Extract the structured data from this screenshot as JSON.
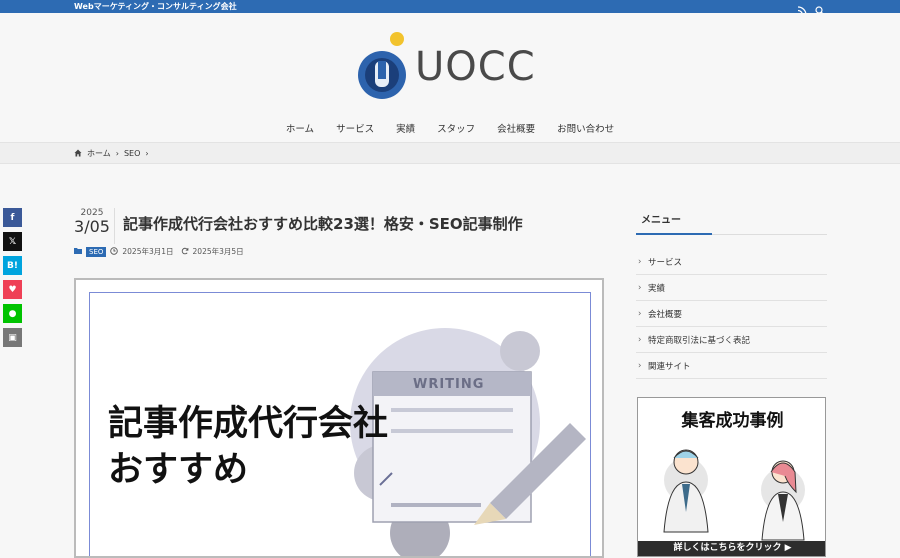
{
  "topbar": {
    "tagline": "Webマーケティング・コンサルティング会社",
    "icons": [
      "rss-icon",
      "search-icon"
    ]
  },
  "logo": {
    "text": "UOCC"
  },
  "nav": [
    "ホーム",
    "サービス",
    "実績",
    "スタッフ",
    "会社概要",
    "お問い合わせ"
  ],
  "breadcrumb": {
    "home": "ホーム",
    "category": "SEO"
  },
  "share": [
    {
      "name": "facebook",
      "label": "f",
      "color": "#3b5998"
    },
    {
      "name": "x",
      "label": "𝕏",
      "color": "#111111"
    },
    {
      "name": "hatena",
      "label": "B!",
      "color": "#00a4de"
    },
    {
      "name": "pocket",
      "label": "♥",
      "color": "#ef4056"
    },
    {
      "name": "line",
      "label": "●",
      "color": "#00c300"
    },
    {
      "name": "copy",
      "label": "▣",
      "color": "#777777"
    }
  ],
  "article": {
    "year": "2025",
    "month_day": "3/05",
    "title": "記事作成代行会社おすすめ比較23選！格安・SEO記事制作",
    "category": "SEO",
    "published": "2025年3月1日",
    "updated": "2025年3月5日",
    "hero_line1": "記事作成代行会社",
    "hero_line2": "おすすめ",
    "hero_writing": "WRITING"
  },
  "sidebar": {
    "menu_title": "メニュー",
    "items": [
      "サービス",
      "実績",
      "会社概要",
      "特定商取引法に基づく表記",
      "関連サイト"
    ],
    "banner_title": "集客成功事例",
    "banner_cta": "詳しくはこちらをクリック ▶"
  },
  "colors": {
    "accent": "#2d6bb3",
    "bg": "#f7f7f7"
  }
}
